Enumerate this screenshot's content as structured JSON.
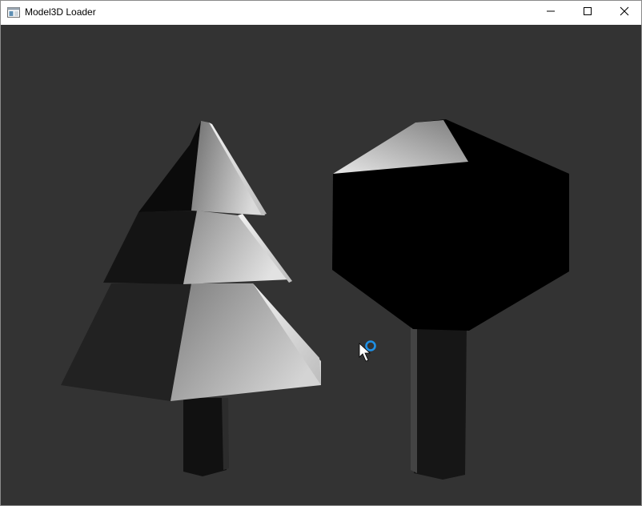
{
  "window": {
    "title": "Model3D Loader",
    "icon": "window-app-icon"
  },
  "titlebar_buttons": {
    "minimize_icon": "minimize-icon",
    "maximize_icon": "maximize-icon",
    "close_icon": "close-icon"
  },
  "viewport": {
    "background_color": "#333333",
    "objects": [
      "pine-tree-model",
      "round-tree-model"
    ],
    "cursor": "arrow-busy-cursor"
  },
  "colors": {
    "busy_ring": "#1e90e6"
  }
}
